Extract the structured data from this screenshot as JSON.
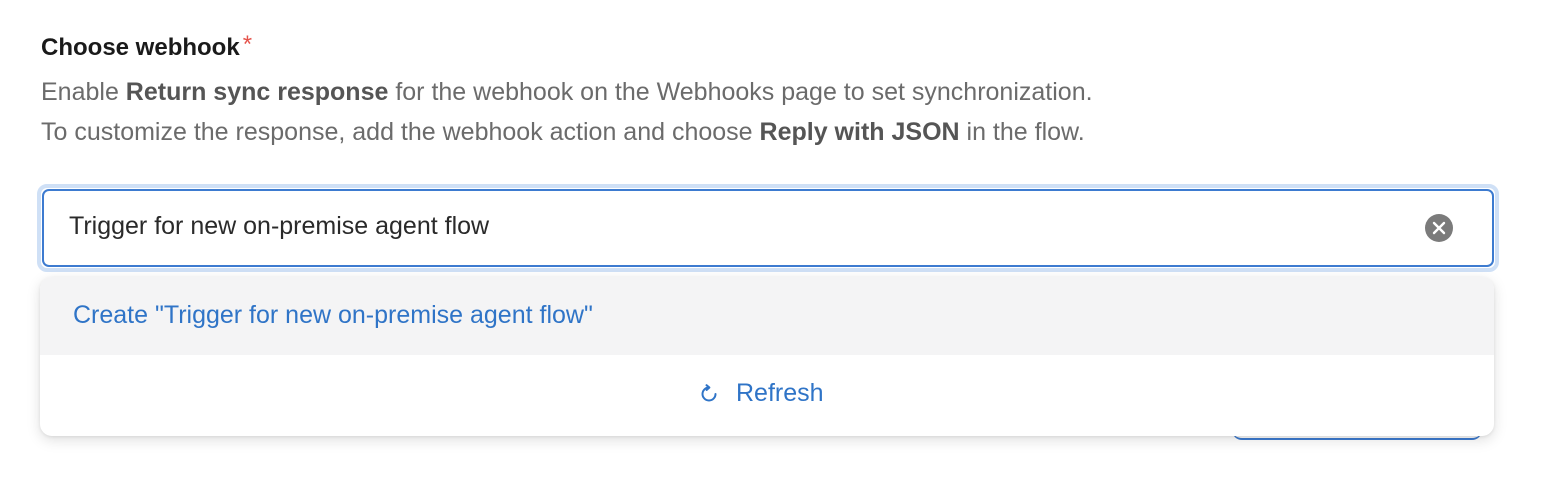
{
  "field": {
    "label": "Choose webhook",
    "required_mark": "*",
    "help_line_1": {
      "pre": "Enable ",
      "bold": "Return sync response",
      "post": " for the webhook on the Webhooks page to set synchronization."
    },
    "help_line_2": {
      "pre": "To customize the response, add the webhook action and choose ",
      "bold": "Reply with JSON",
      "post": " in the flow."
    }
  },
  "input": {
    "value": "Trigger for new on-premise agent flow",
    "clear_icon": "clear-icon"
  },
  "dropdown": {
    "create_option": "Create \"Trigger for new on-premise agent flow\"",
    "refresh_label": "Refresh",
    "refresh_icon": "refresh-icon"
  },
  "colors": {
    "accent": "#2f74c7",
    "focus_border": "#3d7bd0",
    "focus_ring": "#cfe0f6",
    "required": "#e5534b",
    "help_text": "#6b6b6b",
    "option_hover_bg": "#f4f4f5"
  }
}
